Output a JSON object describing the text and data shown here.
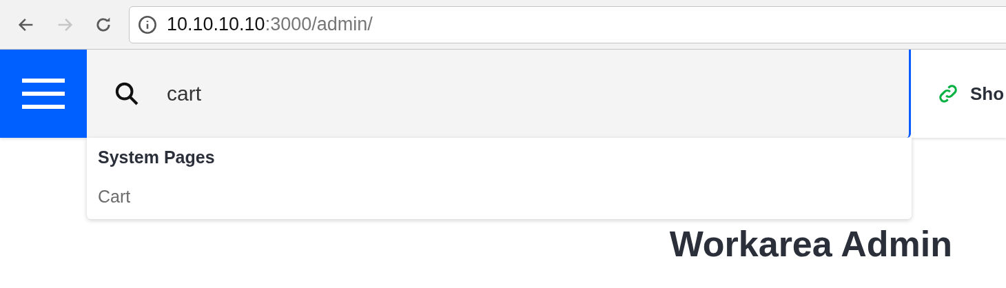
{
  "browser": {
    "nav_buttons": [
      {
        "kind": "back",
        "disabled": false
      },
      {
        "kind": "forward",
        "disabled": true
      },
      {
        "kind": "reload",
        "disabled": false
      }
    ],
    "url": {
      "host": "10.10.10.10",
      "rest": ":3000/admin/"
    }
  },
  "header": {
    "search": {
      "value": "cart",
      "focused": true
    },
    "link": {
      "label": "Sho"
    }
  },
  "search_results": [
    {
      "heading": "System Pages",
      "results": [
        {
          "label": "Cart"
        }
      ]
    }
  ],
  "page": {
    "title": "Workarea Admin"
  }
}
